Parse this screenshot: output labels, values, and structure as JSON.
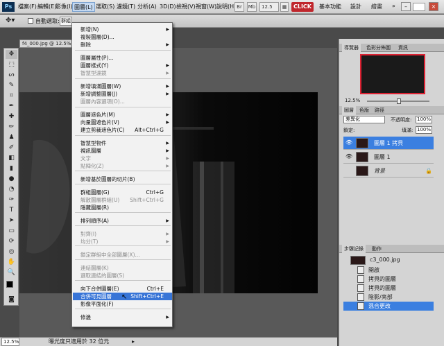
{
  "menubar": {
    "logo": "Ps",
    "items": [
      "檔案(F)",
      "編輯(E)",
      "影像(I)",
      "圖層(L)",
      "選取(S)",
      "濾鏡(T)",
      "分析(A)",
      "3D(D)",
      "檢視(V)",
      "視窗(W)",
      "說明(H)"
    ],
    "br": "Br",
    "mb": "Mb",
    "zoom": "12.5",
    "click_label": "CLICK",
    "workspaces": [
      "基本功能",
      "設計",
      "繪畫"
    ],
    "overflow": "»"
  },
  "options": {
    "auto_select": "自動選取:",
    "target": "群組"
  },
  "document": {
    "tab_title": "f4_000.jpg @ 12.5% (",
    "zoom": "12.5%",
    "status": "曝光度只適用於 32 位元"
  },
  "menu": {
    "items": [
      {
        "label": "新增(N)",
        "submenu": true
      },
      {
        "label": "複製圖層(D)..."
      },
      {
        "label": "刪除",
        "submenu": true
      },
      {
        "label": "圖層屬性(P)..."
      },
      {
        "label": "圖層樣式(Y)",
        "submenu": true
      },
      {
        "label": "智慧型濾鏡",
        "disabled": true,
        "submenu": true
      },
      {
        "label": "新增填滿圖層(W)",
        "submenu": true
      },
      {
        "label": "新增調整圖層(J)",
        "submenu": true
      },
      {
        "label": "圖層內容選項(O)...",
        "disabled": true
      },
      {
        "label": "圖層遮色片(M)",
        "submenu": true
      },
      {
        "label": "向量圖遮色片(V)",
        "submenu": true
      },
      {
        "label": "建立剪裁遮色片(C)",
        "shortcut": "Alt+Ctrl+G"
      },
      {
        "label": "智慧型物件",
        "submenu": true
      },
      {
        "label": "視訊圖層",
        "submenu": true
      },
      {
        "label": "文字",
        "disabled": true,
        "submenu": true
      },
      {
        "label": "點陣化(Z)",
        "disabled": true,
        "submenu": true
      },
      {
        "label": "新增基於圖層的切片(B)"
      },
      {
        "label": "群組圖層(G)",
        "shortcut": "Ctrl+G"
      },
      {
        "label": "解散圖層群組(U)",
        "disabled": true,
        "shortcut": "Shift+Ctrl+G"
      },
      {
        "label": "隱藏圖層(R)"
      },
      {
        "label": "排列順序(A)",
        "submenu": true
      },
      {
        "label": "對齊(I)",
        "disabled": true,
        "submenu": true
      },
      {
        "label": "均分(T)",
        "disabled": true,
        "submenu": true
      },
      {
        "label": "鎖定群組中全部圖層(X)...",
        "disabled": true
      },
      {
        "label": "連結圖層(K)",
        "disabled": true
      },
      {
        "label": "選取連結的圖層(S)",
        "disabled": true
      },
      {
        "label": "向下合併圖層(E)",
        "shortcut": "Ctrl+E"
      },
      {
        "label": "合併可見圖層",
        "shortcut": "Shift+Ctrl+E",
        "highlighted": true
      },
      {
        "label": "影像平面化(F)"
      },
      {
        "label": "修邊",
        "submenu": true
      }
    ]
  },
  "navigator": {
    "tabs": [
      "導覽器",
      "色彩分佈圖",
      "資訊"
    ],
    "zoom": "12.5%"
  },
  "layers": {
    "tabs": [
      "圖層",
      "色版",
      "路徑"
    ],
    "blend_mode": "差異化",
    "opacity_label": "不透明度:",
    "opacity": "100%",
    "lock_label": "鎖定:",
    "fill_label": "填滿:",
    "fill": "100%",
    "items": [
      {
        "name": "圖層 1 拷貝",
        "selected": true
      },
      {
        "name": "圖層 1",
        "selected": false
      },
      {
        "name": "背景",
        "selected": false,
        "italic": true
      }
    ]
  },
  "history": {
    "tabs": [
      "步驟記錄",
      "動作"
    ],
    "snapshot": "c3_000.jpg",
    "items": [
      {
        "label": "開啟",
        "selected": false
      },
      {
        "label": "拷貝的圖層",
        "selected": false
      },
      {
        "label": "拷貝的圖層",
        "selected": false
      },
      {
        "label": "陰影/亮部",
        "selected": false
      },
      {
        "label": "混合更改",
        "selected": true
      }
    ]
  },
  "colors": {
    "accent": "#3875d7",
    "layer_selected": "#3b7fe0",
    "click": "#c0262c"
  }
}
